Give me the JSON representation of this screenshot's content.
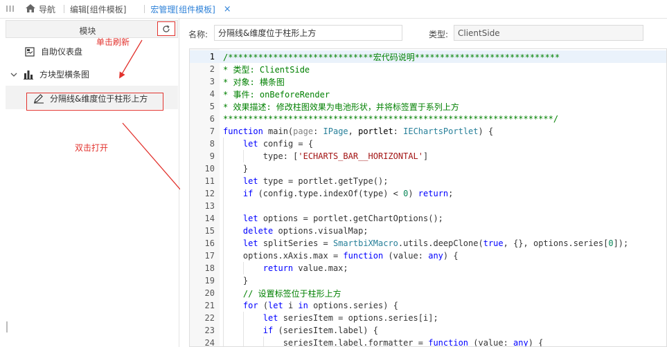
{
  "topbar": {
    "menu_glyph": "III",
    "tabs": [
      {
        "label": "导航",
        "icon": "home-icon"
      },
      {
        "label": "编辑[组件模板]"
      },
      {
        "label": "宏管理[组件模板]",
        "active": true,
        "close": "×"
      }
    ]
  },
  "sidebar": {
    "header": "模块",
    "refresh_icon": "refresh-icon",
    "items": [
      {
        "label": "自助仪表盘",
        "icon": "dashboard-icon"
      },
      {
        "label": "方块型横条图",
        "icon": "bar-chart-icon",
        "expanded": true
      },
      {
        "label": "分隔线&维度位于柱形上方",
        "icon": "macro-edit-icon",
        "selected": true
      }
    ],
    "annotations": {
      "refresh_note": "单击刷新",
      "open_note": "双击打开"
    }
  },
  "form": {
    "name_label": "名称:",
    "name_value": "分隔线&维度位于柱形上方",
    "type_label": "类型:",
    "type_value": "ClientSide"
  },
  "editor": {
    "current_line": 1,
    "lines": [
      {
        "n": "1",
        "html": "<span class=\"cm\">/*****************************宏代码说明*****************************</span>"
      },
      {
        "n": "2",
        "html": "<span class=\"cm\">* 类型: ClientSide</span>"
      },
      {
        "n": "3",
        "html": "<span class=\"cm\">* 对象: 横条图</span>"
      },
      {
        "n": "4",
        "html": "<span class=\"cm\">* 事件: onBeforeRender</span>"
      },
      {
        "n": "5",
        "html": "<span class=\"cm\">* 效果描述: 修改柱图效果为电池形状，并将标签置于系列上方</span>"
      },
      {
        "n": "6",
        "html": "<span class=\"cm\">******************************************************************/</span>"
      },
      {
        "n": "7",
        "html": "<span class=\"kw\">function</span> main(<span class=\"pm\">page</span>: <span class=\"tp\">IPage</span>, <span class=\"df\">portlet</span>: <span class=\"tp\">IEChartsPortlet</span>) {"
      },
      {
        "n": "8",
        "html": "    <span class=\"kw\">let</span> config = {"
      },
      {
        "n": "9",
        "html": "        type: [<span class=\"st\">'ECHARTS_BAR__HORIZONTAL'</span>]"
      },
      {
        "n": "10",
        "html": "    }"
      },
      {
        "n": "11",
        "html": "    <span class=\"kw\">let</span> type = portlet.getType();"
      },
      {
        "n": "12",
        "html": "    <span class=\"kw\">if</span> (config.type.indexOf(type) &lt; <span class=\"num\">0</span>) <span class=\"kw\">return</span>;"
      },
      {
        "n": "13",
        "html": ""
      },
      {
        "n": "14",
        "html": "    <span class=\"kw\">let</span> options = portlet.getChartOptions();"
      },
      {
        "n": "15",
        "html": "    <span class=\"kw\">delete</span> options.visualMap;"
      },
      {
        "n": "16",
        "html": "    <span class=\"kw\">let</span> splitSeries = <span class=\"tp\">SmartbiXMacro</span>.utils.deepClone(<span class=\"kw\">true</span>, {}, options.series[<span class=\"num\">0</span>]);"
      },
      {
        "n": "17",
        "html": "    options.xAxis.max = <span class=\"kw\">function</span> (value: <span class=\"kw\">any</span>) {"
      },
      {
        "n": "18",
        "html": "        <span class=\"kw\">return</span> value.max;"
      },
      {
        "n": "19",
        "html": "    }"
      },
      {
        "n": "20",
        "html": "    <span class=\"cm\">// 设置标签位于柱形上方</span>"
      },
      {
        "n": "21",
        "html": "    <span class=\"kw\">for</span> (<span class=\"kw\">let</span> i <span class=\"kw\">in</span> options.series) {"
      },
      {
        "n": "22",
        "html": "        <span class=\"kw\">let</span> seriesItem = options.series[i];"
      },
      {
        "n": "23",
        "html": "        <span class=\"kw\">if</span> (seriesItem.label) {"
      },
      {
        "n": "24",
        "html": "            seriesItem.label.formatter = <span class=\"kw\">function</span> (value: <span class=\"kw\">any</span>) {"
      }
    ]
  },
  "colors": {
    "accent": "#2f82d8",
    "annotation_red": "#e2322d",
    "comment": "#008000",
    "keyword": "#0000ff",
    "string": "#a31515"
  }
}
